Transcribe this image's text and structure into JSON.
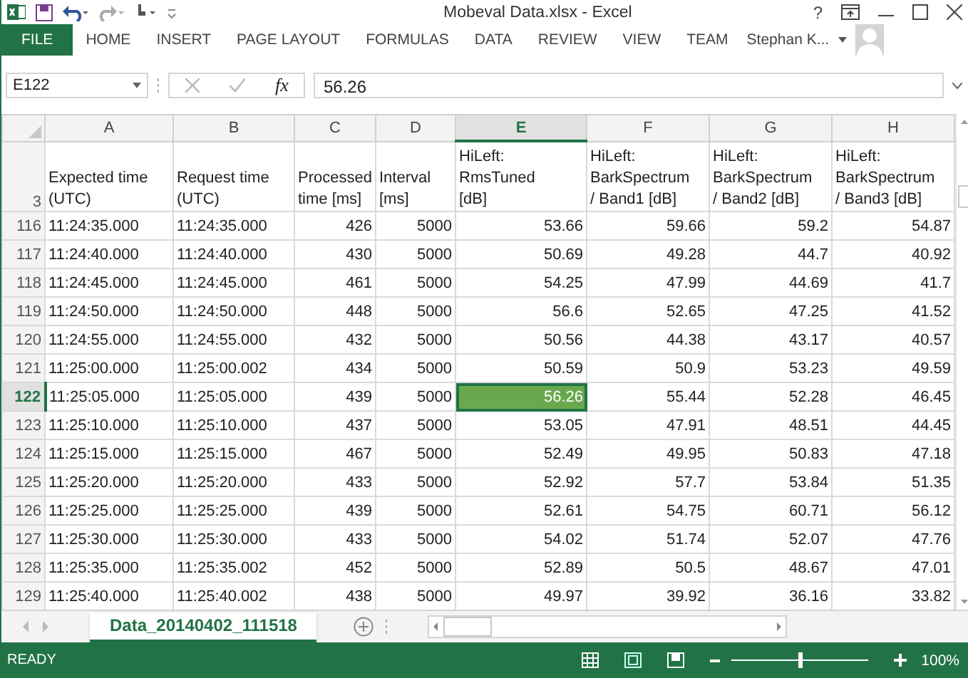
{
  "window": {
    "title": "Mobeval Data.xlsx - Excel",
    "help": "?"
  },
  "ribbon": {
    "tabs": [
      {
        "label": "FILE",
        "selected": true
      },
      {
        "label": "HOME",
        "selected": false
      },
      {
        "label": "INSERT",
        "selected": false
      },
      {
        "label": "PAGE LAYOUT",
        "selected": false
      },
      {
        "label": "FORMULAS",
        "selected": false
      },
      {
        "label": "DATA",
        "selected": false
      },
      {
        "label": "REVIEW",
        "selected": false
      },
      {
        "label": "VIEW",
        "selected": false
      },
      {
        "label": "TEAM",
        "selected": false
      }
    ],
    "user": "Stephan K..."
  },
  "formula_bar": {
    "name_box": "E122",
    "fx": "fx",
    "value": "56.26"
  },
  "sheet": {
    "columns": [
      {
        "letter": "A",
        "kind": "text",
        "selected": false
      },
      {
        "letter": "B",
        "kind": "text",
        "selected": false
      },
      {
        "letter": "C",
        "kind": "number",
        "selected": false
      },
      {
        "letter": "D",
        "kind": "number",
        "selected": false
      },
      {
        "letter": "E",
        "kind": "number",
        "selected": true
      },
      {
        "letter": "F",
        "kind": "number",
        "selected": false
      },
      {
        "letter": "G",
        "kind": "number",
        "selected": false
      },
      {
        "letter": "H",
        "kind": "number",
        "selected": false
      }
    ],
    "header_row": {
      "number": "3",
      "cells": [
        [
          "Expected time",
          "(UTC)"
        ],
        [
          "Request time",
          "(UTC)"
        ],
        [
          "Processed",
          "time [ms]"
        ],
        [
          "Interval",
          "[ms]"
        ],
        [
          "HiLeft:",
          "RmsTuned",
          "[dB]"
        ],
        [
          "HiLeft:",
          "BarkSpectrum",
          "/ Band1 [dB]"
        ],
        [
          "HiLeft:",
          "BarkSpectrum",
          "/ Band2 [dB]"
        ],
        [
          "HiLeft:",
          "BarkSpectrum",
          "/ Band3 [dB]"
        ]
      ]
    },
    "rows": [
      {
        "number": "116",
        "selected": false,
        "cells": [
          "11:24:35.000",
          "11:24:35.000",
          "426",
          "5000",
          "53.66",
          "59.66",
          "59.2",
          "54.87"
        ]
      },
      {
        "number": "117",
        "selected": false,
        "cells": [
          "11:24:40.000",
          "11:24:40.000",
          "430",
          "5000",
          "50.69",
          "49.28",
          "44.7",
          "40.92"
        ]
      },
      {
        "number": "118",
        "selected": false,
        "cells": [
          "11:24:45.000",
          "11:24:45.000",
          "461",
          "5000",
          "54.25",
          "47.99",
          "44.69",
          "41.7"
        ]
      },
      {
        "number": "119",
        "selected": false,
        "cells": [
          "11:24:50.000",
          "11:24:50.000",
          "448",
          "5000",
          "56.6",
          "52.65",
          "47.25",
          "41.52"
        ]
      },
      {
        "number": "120",
        "selected": false,
        "cells": [
          "11:24:55.000",
          "11:24:55.000",
          "432",
          "5000",
          "50.56",
          "44.38",
          "43.17",
          "40.57"
        ]
      },
      {
        "number": "121",
        "selected": false,
        "cells": [
          "11:25:00.000",
          "11:25:00.002",
          "434",
          "5000",
          "50.59",
          "50.9",
          "53.23",
          "49.59"
        ]
      },
      {
        "number": "122",
        "selected": true,
        "cells": [
          "11:25:05.000",
          "11:25:05.000",
          "439",
          "5000",
          "56.26",
          "55.44",
          "52.28",
          "46.45"
        ]
      },
      {
        "number": "123",
        "selected": false,
        "cells": [
          "11:25:10.000",
          "11:25:10.000",
          "437",
          "5000",
          "53.05",
          "47.91",
          "48.51",
          "44.45"
        ]
      },
      {
        "number": "124",
        "selected": false,
        "cells": [
          "11:25:15.000",
          "11:25:15.000",
          "467",
          "5000",
          "52.49",
          "49.95",
          "50.83",
          "47.18"
        ]
      },
      {
        "number": "125",
        "selected": false,
        "cells": [
          "11:25:20.000",
          "11:25:20.000",
          "433",
          "5000",
          "52.92",
          "57.7",
          "53.84",
          "51.35"
        ]
      },
      {
        "number": "126",
        "selected": false,
        "cells": [
          "11:25:25.000",
          "11:25:25.000",
          "439",
          "5000",
          "52.61",
          "54.75",
          "60.71",
          "56.12"
        ]
      },
      {
        "number": "127",
        "selected": false,
        "cells": [
          "11:25:30.000",
          "11:25:30.000",
          "433",
          "5000",
          "54.02",
          "51.74",
          "52.07",
          "47.76"
        ]
      },
      {
        "number": "128",
        "selected": false,
        "cells": [
          "11:25:35.000",
          "11:25:35.002",
          "452",
          "5000",
          "52.89",
          "50.5",
          "48.67",
          "47.01"
        ]
      },
      {
        "number": "129",
        "selected": false,
        "cells": [
          "11:25:40.000",
          "11:25:40.002",
          "438",
          "5000",
          "49.97",
          "39.92",
          "36.16",
          "33.82"
        ]
      }
    ]
  },
  "sheet_tabs": [
    {
      "label": "Data_20140402_111518",
      "selected": true
    }
  ],
  "status_bar": {
    "text": "READY",
    "zoom": {
      "level": 0.5
    },
    "zoom_label": "100%"
  }
}
